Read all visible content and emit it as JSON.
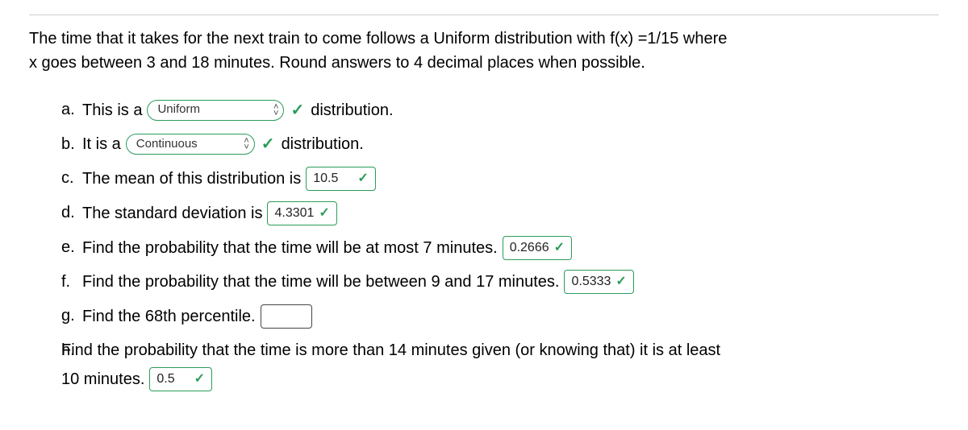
{
  "prompt": {
    "line1": "The time that it takes for the next train to come follows a Uniform distribution with f(x) =1/15 where",
    "line2": "x goes between 3 and 18 minutes. Round answers to 4 decimal places when possible."
  },
  "items": {
    "a": {
      "marker": "a.",
      "prefix": "This is a",
      "select_value": "Uniform",
      "suffix": "distribution."
    },
    "b": {
      "marker": "b.",
      "prefix": "It is a",
      "select_value": "Continuous",
      "suffix": "distribution."
    },
    "c": {
      "marker": "c.",
      "prefix": "The mean of this distribution is",
      "value": "10.5"
    },
    "d": {
      "marker": "d.",
      "prefix": "The standard deviation is",
      "value": "4.3301"
    },
    "e": {
      "marker": "e.",
      "prefix": "Find the probability that the time will be at most 7 minutes.",
      "value": "0.2666"
    },
    "f": {
      "marker": "f.",
      "prefix": "Find the probability that the time will be between 9 and 17 minutes.",
      "value": "0.5333"
    },
    "g": {
      "marker": "g.",
      "prefix": "Find the 68th percentile.",
      "value": ""
    },
    "h": {
      "marker": "h.",
      "line1": "Find the probability that the time is more than 14 minutes given (or knowing that) it is at least",
      "line2_prefix": "10 minutes.",
      "value": "0.5"
    }
  },
  "icons": {
    "up": "˄",
    "down": "˅",
    "check": "✓"
  }
}
